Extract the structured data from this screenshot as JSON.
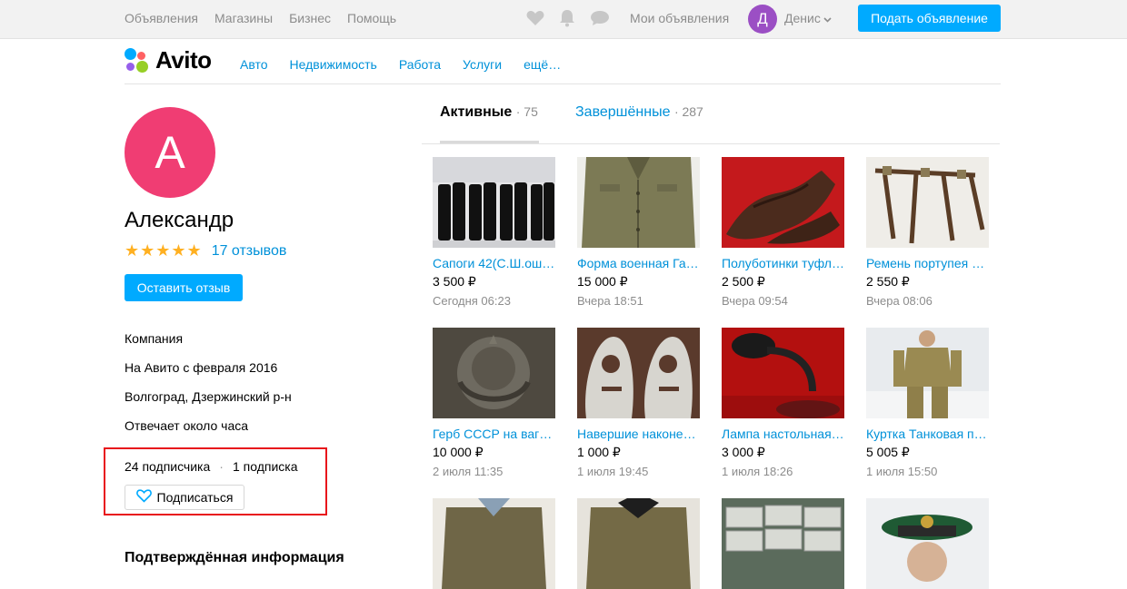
{
  "topbar": {
    "nav": [
      "Объявления",
      "Магазины",
      "Бизнес",
      "Помощь"
    ],
    "my_ads": "Мои объявления",
    "avatar_letter": "Д",
    "user_name": "Денис",
    "post_button": "Подать объявление"
  },
  "header": {
    "logo": "Avito",
    "categories": [
      "Авто",
      "Недвижимость",
      "Работа",
      "Услуги",
      "ещё…"
    ]
  },
  "profile": {
    "avatar_letter": "А",
    "name": "Александр",
    "stars": "★★★★★",
    "reviews": "17 отзывов",
    "review_button": "Оставить отзыв",
    "info": [
      "Компания",
      "На Авито с февраля 2016",
      "Волгоград, Дзержинский р-н",
      "Отвечает около часа"
    ],
    "subscribers": "24 подписчика",
    "separator": "·",
    "subscriptions": "1 подписка",
    "subscribe_button": "Подписаться",
    "verified_title": "Подтверждённая информация"
  },
  "tabs": {
    "active_label": "Активные",
    "active_count": "· 75",
    "done_label": "Завершённые",
    "done_count": "· 287"
  },
  "items": [
    {
      "title": "Сапоги 42(С.Ш.ош…",
      "price": "3 500 ₽",
      "date": "Сегодня 06:23"
    },
    {
      "title": "Форма военная Га…",
      "price": "15 000 ₽",
      "date": "Вчера 18:51"
    },
    {
      "title": "Полуботинки туфл…",
      "price": "2 500 ₽",
      "date": "Вчера 09:54"
    },
    {
      "title": "Ремень портупея …",
      "price": "2 550 ₽",
      "date": "Вчера 08:06"
    },
    {
      "title": "Герб СССР на ваг…",
      "price": "10 000 ₽",
      "date": "2 июля 11:35"
    },
    {
      "title": "Навершие наконе…",
      "price": "1 000 ₽",
      "date": "1 июля 19:45"
    },
    {
      "title": "Лампа настольная…",
      "price": "3 000 ₽",
      "date": "1 июля 18:26"
    },
    {
      "title": "Куртка Танковая п…",
      "price": "5 005 ₽",
      "date": "1 июля 15:50"
    },
    {
      "title": "",
      "price": "",
      "date": ""
    },
    {
      "title": "",
      "price": "",
      "date": ""
    },
    {
      "title": "",
      "price": "",
      "date": ""
    },
    {
      "title": "",
      "price": "",
      "date": ""
    }
  ],
  "colors": {
    "accent": "#00aaff",
    "link": "#0091d9",
    "avatar_big": "#f03d73",
    "avatar_small": "#9b4fc4",
    "stars": "#ffb021",
    "highlight_box": "#e8141b"
  },
  "icons": [
    "heart-icon",
    "bell-icon",
    "chat-icon",
    "chevron-down-icon",
    "heart-outline-icon"
  ]
}
